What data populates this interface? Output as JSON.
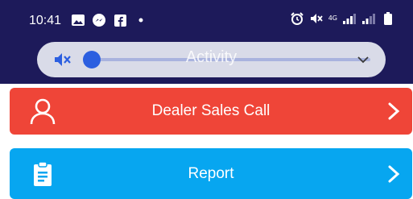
{
  "status_bar": {
    "time": "10:41",
    "left_icons": [
      "gallery-icon",
      "messenger-icon",
      "facebook-icon",
      "dot-icon"
    ],
    "right_icons": [
      "alarm-icon",
      "mute-icon",
      "4g-icon",
      "signal-icon",
      "signal-icon",
      "battery-icon"
    ],
    "network_label": "4G"
  },
  "volume_panel": {
    "label": "Activity",
    "level": 0.0,
    "icon": "mute-icon"
  },
  "menu": {
    "items": [
      {
        "label": "Dealer Sales Call",
        "icon": "person-icon",
        "color": "#ef4538"
      },
      {
        "label": "Report",
        "icon": "clipboard-icon",
        "color": "#07a6f0"
      }
    ]
  },
  "colors": {
    "status_bar_bg": "#1d1a5a",
    "volume_accent": "#2c5fe0"
  }
}
